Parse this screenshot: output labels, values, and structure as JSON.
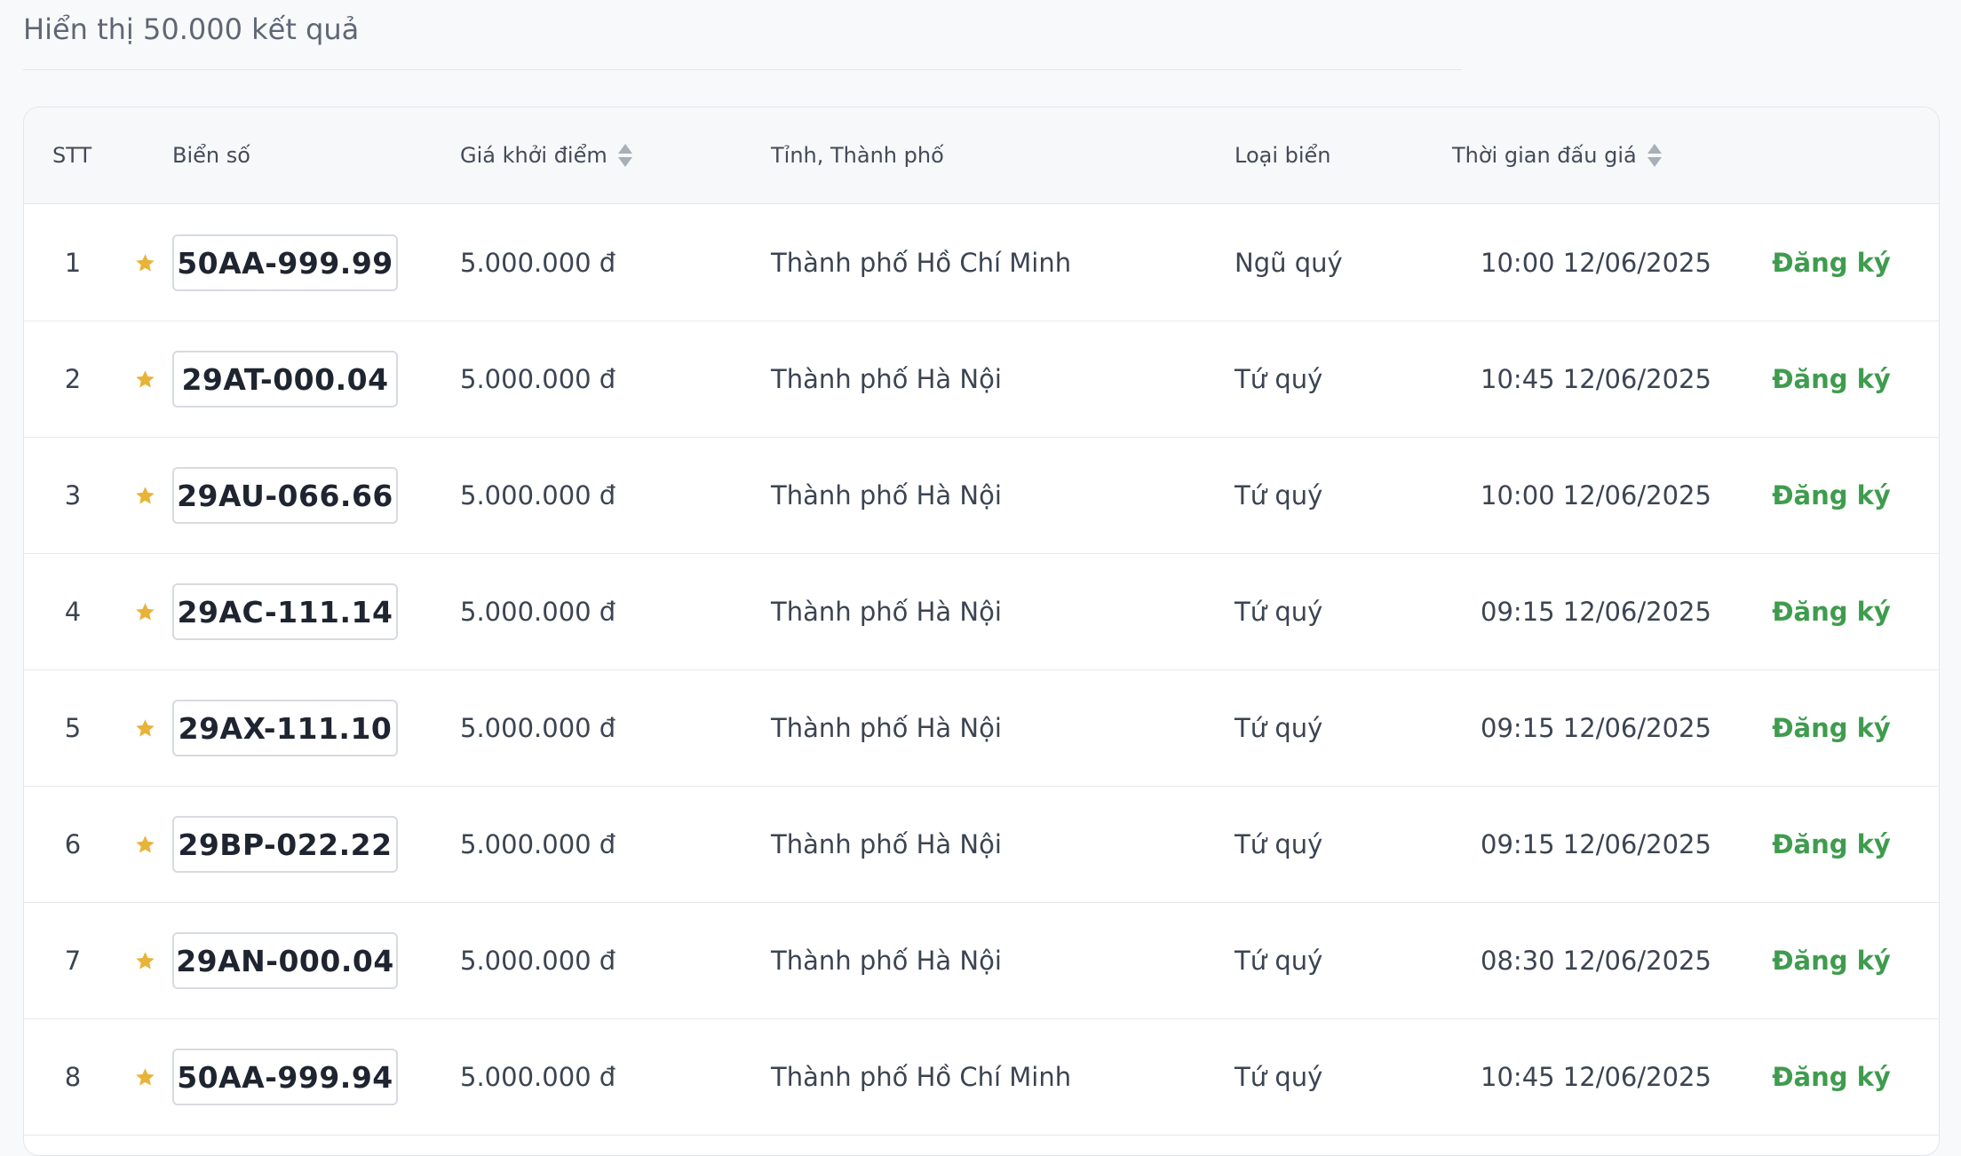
{
  "results_summary": "Hiển thị 50.000 kết quả",
  "columns": {
    "stt": "STT",
    "plate": "Biển số",
    "price": "Giá khởi điểm",
    "province": "Tỉnh, Thành phố",
    "plate_type": "Loại biển",
    "auction_time": "Thời gian đấu giá"
  },
  "accent_colors": {
    "star": "#e8b339",
    "action": "#3f9c4e"
  },
  "rows": [
    {
      "stt": "1",
      "plate": "50AA-999.99",
      "price": "5.000.000 đ",
      "province": "Thành phố Hồ Chí Minh",
      "plate_type": "Ngũ quý",
      "auction_time": "10:00 12/06/2025",
      "action": "Đăng ký"
    },
    {
      "stt": "2",
      "plate": "29AT-000.04",
      "price": "5.000.000 đ",
      "province": "Thành phố Hà Nội",
      "plate_type": "Tứ quý",
      "auction_time": "10:45 12/06/2025",
      "action": "Đăng ký"
    },
    {
      "stt": "3",
      "plate": "29AU-066.66",
      "price": "5.000.000 đ",
      "province": "Thành phố Hà Nội",
      "plate_type": "Tứ quý",
      "auction_time": "10:00 12/06/2025",
      "action": "Đăng ký"
    },
    {
      "stt": "4",
      "plate": "29AC-111.14",
      "price": "5.000.000 đ",
      "province": "Thành phố Hà Nội",
      "plate_type": "Tứ quý",
      "auction_time": "09:15 12/06/2025",
      "action": "Đăng ký"
    },
    {
      "stt": "5",
      "plate": "29AX-111.10",
      "price": "5.000.000 đ",
      "province": "Thành phố Hà Nội",
      "plate_type": "Tứ quý",
      "auction_time": "09:15 12/06/2025",
      "action": "Đăng ký"
    },
    {
      "stt": "6",
      "plate": "29BP-022.22",
      "price": "5.000.000 đ",
      "province": "Thành phố Hà Nội",
      "plate_type": "Tứ quý",
      "auction_time": "09:15 12/06/2025",
      "action": "Đăng ký"
    },
    {
      "stt": "7",
      "plate": "29AN-000.04",
      "price": "5.000.000 đ",
      "province": "Thành phố Hà Nội",
      "plate_type": "Tứ quý",
      "auction_time": "08:30 12/06/2025",
      "action": "Đăng ký"
    },
    {
      "stt": "8",
      "plate": "50AA-999.94",
      "price": "5.000.000 đ",
      "province": "Thành phố Hồ Chí Minh",
      "plate_type": "Tứ quý",
      "auction_time": "10:45 12/06/2025",
      "action": "Đăng ký"
    }
  ]
}
